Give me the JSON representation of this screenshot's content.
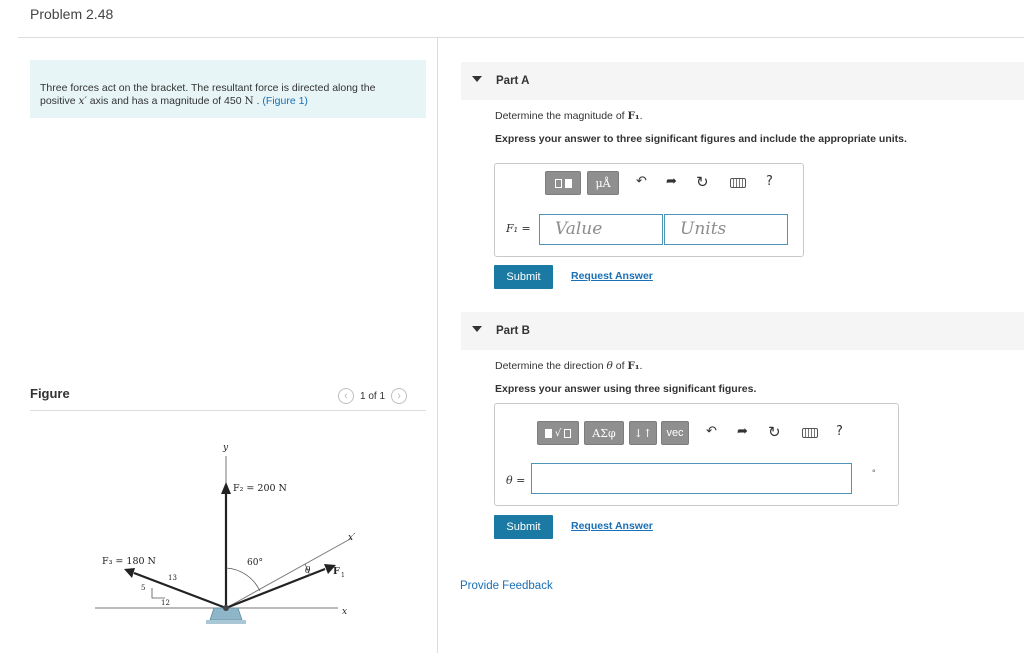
{
  "header": {
    "problem_title": "Problem 2.48"
  },
  "statement": {
    "text_before": "Three forces act on the bracket. The resultant force is directed along the positive ",
    "axis_var": "x′",
    "text_middle": " axis and has a magnitude of 450 ",
    "unit": "N",
    "text_after": " . ",
    "figure_link": "(Figure 1)"
  },
  "figure": {
    "heading": "Figure",
    "pager": "1 of 1",
    "labels": {
      "y_axis": "y",
      "x_axis": "x",
      "x_prime": "x′",
      "f2": "F₂ = 200 N",
      "f3": "F₃ = 180 N",
      "f1": "F",
      "f1_sub": "1",
      "angle_60": "60°",
      "theta": "θ",
      "slope_13": "13",
      "slope_5": "5",
      "slope_12": "12"
    }
  },
  "partA": {
    "label": "Part A",
    "question_pre": "Determine the magnitude of ",
    "question_var": "F₁",
    "question_post": ".",
    "instruction": "Express your answer to three significant figures and include the appropriate units.",
    "toolbar": {
      "units_button": "μÅ",
      "help": "?"
    },
    "variable_label": "F₁ =",
    "value_placeholder": "Value",
    "units_placeholder": "Units",
    "submit": "Submit",
    "request_answer": "Request Answer"
  },
  "partB": {
    "label": "Part B",
    "question_pre": "Determine the direction ",
    "question_theta": "θ",
    "question_mid": " of ",
    "question_var": "F₁",
    "question_post": ".",
    "instruction": "Express your answer using three significant figures.",
    "toolbar": {
      "greek_button": "ΑΣφ",
      "sort_button": "↓↑",
      "vec_button": "vec",
      "help": "?"
    },
    "variable_label": "θ =",
    "input_value": "",
    "trailing_mark": "°",
    "submit": "Submit",
    "request_answer": "Request Answer"
  },
  "footer": {
    "provide_feedback": "Provide Feedback"
  }
}
